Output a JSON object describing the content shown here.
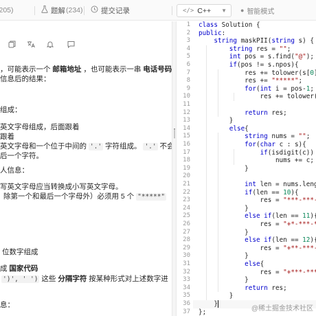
{
  "tabs": {
    "solutions": {
      "label": "",
      "count": "(205)"
    },
    "discussion": {
      "label": "题解",
      "count": "(234)",
      "icon": "flask-icon"
    },
    "submissions": {
      "label": "提交记录",
      "icon": "history-icon"
    }
  },
  "editor_header": {
    "language": "C++",
    "language_icon": "code-icon",
    "smart_mode": "智能模式",
    "smart_mode_icon": "dot-icon"
  },
  "description_toolbar": {
    "icons": [
      "copy-icon",
      "translate-icon",
      "bell-icon",
      "comment-icon"
    ]
  },
  "description": {
    "line1_pre": "，可能表示一个",
    "line1_b1": "邮箱地址",
    "line1_mid": "，也可能表示一串",
    "line1_b2": "电话号码",
    "line2": "信息后的结果：",
    "line3": "组成：",
    "line4": "英文字母组成，后面跟着",
    "line5": "跟着",
    "line6_pre": "英文字母和一个位于中间的",
    "line6_code1": "'.'",
    "line6_mid": "字符组成。",
    "line6_code2": "'.'",
    "line6_post": "不会",
    "line7": "后一个字符。",
    "line8": "人信息：",
    "line9": "写英文字母应当转换成小写英文字母。",
    "line10_pre": "除第一个和最后一个字母外）必须用 5 个",
    "line10_code": "\"*****\"",
    "line11": "位数字组成",
    "line12_pre": "成",
    "line12_b": "国家代码",
    "line13_pre": "')', ' ')",
    "line13_mid": "这些",
    "line13_b": "分隔字符",
    "line13_post": "按某种形式对上述数字进",
    "line14": "息："
  },
  "code": {
    "line_numbers": [
      "1",
      "2",
      "3",
      "4",
      "5",
      "6",
      "7",
      "8",
      "9",
      "10",
      "11",
      "12",
      "13",
      "14",
      "15",
      "16",
      "17",
      "18",
      "19",
      "20",
      "21",
      "22",
      "23",
      "24",
      "25",
      "26",
      "27",
      "28",
      "29",
      "30",
      "31",
      "32",
      "33",
      "34",
      "35",
      "36",
      "37"
    ],
    "l1": "class Solution {",
    "l2": "public:",
    "l3": "    string maskPII(string s) {",
    "l4": "        string res = \"\";",
    "l5": "        int pos = s.find(\"@\");",
    "l6": "        if(pos != s.npos){",
    "l7": "            res += tolower(s[0]);",
    "l8": "            res += \"*****\";",
    "l9": "            for(int i = pos-1; i<s.l",
    "l10": "                res += tolower(s[i])",
    "l11": "",
    "l12": "            return res;",
    "l13": "        }",
    "l14": "        else{",
    "l15": "            string nums = \"\";",
    "l16": "            for(char c : s){",
    "l17": "                if(isdigit(c))",
    "l18": "                    nums += c;",
    "l19": "            }",
    "l20": "",
    "l21": "            int len = nums.length();",
    "l22": "            if(len == 10){",
    "l23": "                res = \"***-***-\" + nu",
    "l24": "            }",
    "l25": "            else if(len == 11){",
    "l26": "                res = \"+*-***-***-\"",
    "l27": "            }",
    "l28": "            else if(len == 12){",
    "l29": "                res = \"+**-***-***-",
    "l30": "            }",
    "l31": "            else{",
    "l32": "                res = \"+***-***-***-",
    "l33": "            }",
    "l34": "            return res;",
    "l35": "        }",
    "l36": "    }",
    "l37": "};"
  },
  "watermark": "@稀土掘金技术社区"
}
